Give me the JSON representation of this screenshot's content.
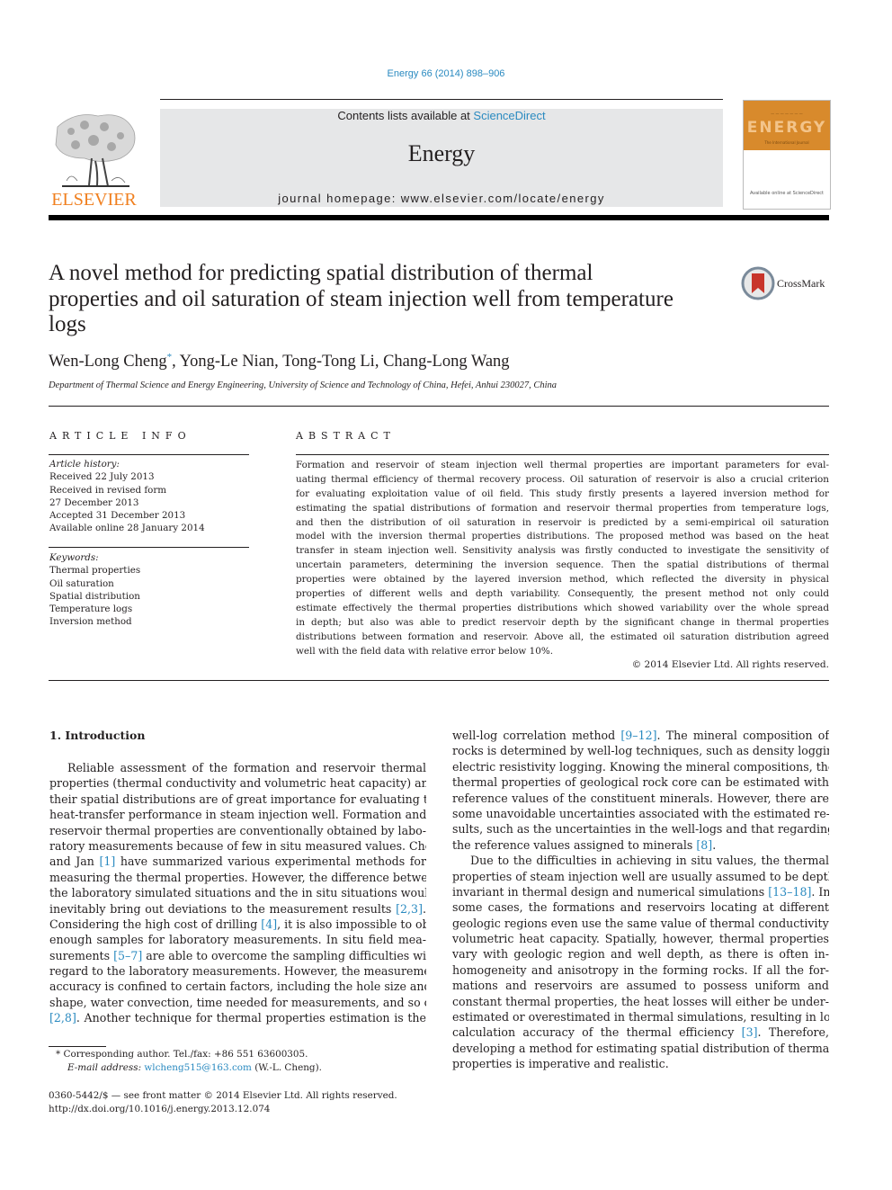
{
  "header": {
    "journal_reference": "Energy 66 (2014) 898–906",
    "contents_prefix": "Contents lists available at ",
    "contents_link": "ScienceDirect",
    "journal_title": "Energy",
    "homepage": "journal homepage: www.elsevier.com/locate/energy",
    "publisher_logo_text": "ELSEVIER",
    "cover_title": "ENERGY",
    "cover_tagline": "The International Journal",
    "cover_footer": "Available online at ScienceDirect"
  },
  "article": {
    "title_lines": [
      "A novel method for predicting spatial distribution of thermal",
      "properties and oil saturation of steam injection well from temperature",
      "logs"
    ],
    "crossmark_label": "CrossMark",
    "authors": {
      "first": "Wen-Long Cheng",
      "first_marker": "*",
      "rest": ", Yong-Le Nian, Tong-Tong Li, Chang-Long Wang"
    },
    "affiliation": "Department of Thermal Science and Energy Engineering, University of Science and Technology of China, Hefei, Anhui 230027, China"
  },
  "article_info": {
    "heading": "ARTICLE INFO",
    "history_label": "Article history:",
    "history": [
      "Received 22 July 2013",
      "Received in revised form",
      "27 December 2013",
      "Accepted 31 December 2013",
      "Available online 28 January 2014"
    ],
    "keywords_label": "Keywords:",
    "keywords": [
      "Thermal properties",
      "Oil saturation",
      "Spatial distribution",
      "Temperature logs",
      "Inversion method"
    ]
  },
  "abstract": {
    "heading": "ABSTRACT",
    "lines": [
      "Formation and reservoir of steam injection well thermal properties are important parameters for eval-",
      "uating thermal efficiency of thermal recovery process. Oil saturation of reservoir is also a crucial criterion",
      "for evaluating exploitation value of oil field. This study firstly presents a layered inversion method for",
      "estimating the spatial distributions of formation and reservoir thermal properties from temperature logs,",
      "and then the distribution of oil saturation in reservoir is predicted by a semi-empirical oil saturation",
      "model with the inversion thermal properties distributions. The proposed method was based on the heat",
      "transfer in steam injection well. Sensitivity analysis was firstly conducted to investigate the sensitivity of",
      "uncertain parameters, determining the inversion sequence. Then the spatial distributions of thermal",
      "properties were obtained by the layered inversion method, which reflected the diversity in physical",
      "properties of different wells and depth variability. Consequently, the present method not only could",
      "estimate effectively the thermal properties distributions which showed variability over the whole spread",
      "in depth; but also was able to predict reservoir depth by the significant change in thermal properties",
      "distributions between formation and reservoir. Above all, the estimated oil saturation distribution agreed",
      "well with the field data with relative error below 10%."
    ],
    "copyright": "© 2014 Elsevier Ltd. All rights reserved."
  },
  "introduction": {
    "heading": "1.  Introduction",
    "left_lines": [
      [
        {
          "t": "Reliable assessment of the formation and reservoir thermal"
        }
      ],
      [
        {
          "t": "properties (thermal conductivity and volumetric heat capacity) and"
        }
      ],
      [
        {
          "t": "their spatial distributions are of great importance for evaluating the"
        }
      ],
      [
        {
          "t": "heat-transfer performance in steam injection well. Formation and"
        }
      ],
      [
        {
          "t": "reservoir thermal properties are conventionally obtained by labo-"
        }
      ],
      [
        {
          "t": "ratory measurements because of few in situ measured values. Cheng"
        }
      ],
      [
        {
          "t": "and Jan "
        },
        {
          "t": "[1]",
          "link": true
        },
        {
          "t": " have summarized various experimental methods for"
        }
      ],
      [
        {
          "t": "measuring the thermal properties. However, the difference between"
        }
      ],
      [
        {
          "t": "the laboratory simulated situations and the in situ situations would"
        }
      ],
      [
        {
          "t": "inevitably bring out deviations to the measurement results "
        },
        {
          "t": "[2,3]",
          "link": true
        },
        {
          "t": "."
        }
      ],
      [
        {
          "t": "Considering the high cost of drilling "
        },
        {
          "t": "[4]",
          "link": true
        },
        {
          "t": ", it is also impossible to obtain"
        }
      ],
      [
        {
          "t": "enough samples for laboratory measurements. In situ field mea-"
        }
      ],
      [
        {
          "t": "surements "
        },
        {
          "t": "[5–7]",
          "link": true
        },
        {
          "t": " are able to overcome the sampling difficulties with"
        }
      ],
      [
        {
          "t": "regard to the laboratory measurements. However, the measurement"
        }
      ],
      [
        {
          "t": "accuracy is confined to certain factors, including the hole size and"
        }
      ],
      [
        {
          "t": "shape, water convection, time needed for measurements, and so on"
        }
      ],
      [
        {
          "t": "[2,8]",
          "link": true
        },
        {
          "t": ". Another technique for thermal properties estimation is the"
        }
      ]
    ],
    "right_lines": [
      [
        {
          "t": "well-log correlation method "
        },
        {
          "t": "[9–12]",
          "link": true
        },
        {
          "t": ". The mineral composition of"
        }
      ],
      [
        {
          "t": "rocks is determined by well-log techniques, such as density logging,"
        }
      ],
      [
        {
          "t": "electric resistivity logging. Knowing the mineral compositions, the"
        }
      ],
      [
        {
          "t": "thermal properties of geological rock core can be estimated with"
        }
      ],
      [
        {
          "t": "reference values of the constituent minerals. However, there are"
        }
      ],
      [
        {
          "t": "some unavoidable uncertainties associated with the estimated re-"
        }
      ],
      [
        {
          "t": "sults, such as the uncertainties in the well-logs and that regarding"
        }
      ],
      [
        {
          "t": "the reference values assigned to minerals "
        },
        {
          "t": "[8]",
          "link": true
        },
        {
          "t": "."
        }
      ],
      [
        {
          "t": "Due to the difficulties in achieving in situ values, the thermal"
        }
      ],
      [
        {
          "t": "properties of steam injection well are usually assumed to be depth-"
        }
      ],
      [
        {
          "t": "invariant in thermal design and numerical simulations "
        },
        {
          "t": "[13–18]",
          "link": true
        },
        {
          "t": ". In"
        }
      ],
      [
        {
          "t": "some cases, the formations and reservoirs locating at different"
        }
      ],
      [
        {
          "t": "geologic regions even use the same value of thermal conductivity or"
        }
      ],
      [
        {
          "t": "volumetric heat capacity. Spatially, however, thermal properties"
        }
      ],
      [
        {
          "t": "vary with geologic region and well depth, as there is often in-"
        }
      ],
      [
        {
          "t": "homogeneity and anisotropy in the forming rocks. If all the for-"
        }
      ],
      [
        {
          "t": "mations and reservoirs are assumed to possess uniform and"
        }
      ],
      [
        {
          "t": "constant thermal properties, the heat losses will either be under-"
        }
      ],
      [
        {
          "t": "estimated or overestimated in thermal simulations, resulting in low"
        }
      ],
      [
        {
          "t": "calculation accuracy of the thermal efficiency "
        },
        {
          "t": "[3]",
          "link": true
        },
        {
          "t": ". Therefore,"
        }
      ],
      [
        {
          "t": "developing a method for estimating spatial distribution of thermal"
        }
      ],
      [
        {
          "t": "properties is imperative and realistic."
        }
      ]
    ]
  },
  "footnote": {
    "marker": "*",
    "corresponding": " Corresponding author. Tel./fax: +86 551 63600305.",
    "email_label": "E-mail address: ",
    "email": "wlcheng515@163.com",
    "email_suffix": " (W.-L. Cheng)."
  },
  "front_matter": {
    "issn_line": "0360-5442/$ — see front matter © 2014 Elsevier Ltd. All rights reserved.",
    "doi": "http://dx.doi.org/10.1016/j.energy.2013.12.074"
  },
  "colors": {
    "link": "#2a8ac0",
    "elsevier_orange": "#f07f1e",
    "masthead_gray": "#e6e7e8",
    "cover_orange": "#d88a2c",
    "crossmark_red": "#c8352b"
  }
}
